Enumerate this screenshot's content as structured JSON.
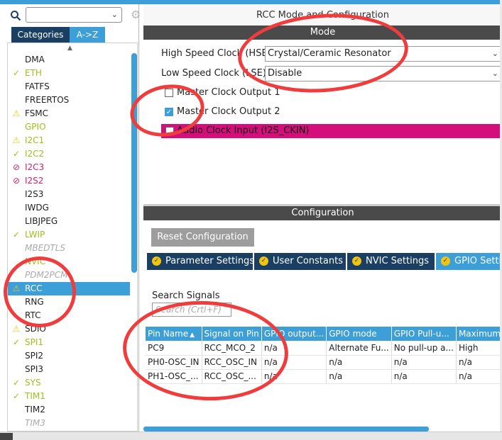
{
  "left_panel": {
    "search": {
      "value": ""
    },
    "tabs": {
      "categories": "Categories",
      "az": "A->Z"
    },
    "items": [
      {
        "label": "DMA",
        "icon": "",
        "style": "normal"
      },
      {
        "label": "ETH",
        "icon": "check",
        "style": "green"
      },
      {
        "label": "FATFS",
        "icon": "",
        "style": "normal"
      },
      {
        "label": "FREERTOS",
        "icon": "",
        "style": "normal"
      },
      {
        "label": "FSMC",
        "icon": "warn",
        "style": "normal"
      },
      {
        "label": "GPIO",
        "icon": "",
        "style": "green"
      },
      {
        "label": "I2C1",
        "icon": "warn",
        "style": "green"
      },
      {
        "label": "I2C2",
        "icon": "check",
        "style": "green"
      },
      {
        "label": "I2C3",
        "icon": "ban",
        "style": "pink"
      },
      {
        "label": "I2S2",
        "icon": "ban",
        "style": "pink"
      },
      {
        "label": "I2S3",
        "icon": "",
        "style": "normal"
      },
      {
        "label": "IWDG",
        "icon": "",
        "style": "normal"
      },
      {
        "label": "LIBJPEG",
        "icon": "",
        "style": "normal"
      },
      {
        "label": "LWIP",
        "icon": "check",
        "style": "green"
      },
      {
        "label": "MBEDTLS",
        "icon": "",
        "style": "gray"
      },
      {
        "label": "NVIC",
        "icon": "",
        "style": "green"
      },
      {
        "label": "PDM2PCM",
        "icon": "",
        "style": "gray"
      },
      {
        "label": "RCC",
        "icon": "warn",
        "style": "selected"
      },
      {
        "label": "RNG",
        "icon": "",
        "style": "normal"
      },
      {
        "label": "RTC",
        "icon": "",
        "style": "normal"
      },
      {
        "label": "SDIO",
        "icon": "warn",
        "style": "normal"
      },
      {
        "label": "SPI1",
        "icon": "check",
        "style": "green"
      },
      {
        "label": "SPI2",
        "icon": "",
        "style": "normal"
      },
      {
        "label": "SPI3",
        "icon": "",
        "style": "normal"
      },
      {
        "label": "SYS",
        "icon": "check",
        "style": "green"
      },
      {
        "label": "TIM1",
        "icon": "check",
        "style": "green"
      },
      {
        "label": "TIM2",
        "icon": "",
        "style": "normal"
      },
      {
        "label": "TIM3",
        "icon": "",
        "style": "gray"
      }
    ]
  },
  "right_panel": {
    "title": "RCC Mode and Configuration",
    "mode_bar": "Mode",
    "hse": {
      "label": "High Speed Clock (HSE)",
      "value": "Crystal/Ceramic Resonator"
    },
    "lse": {
      "label": "Low Speed Clock (LSE)",
      "value": "Disable"
    },
    "mco1": {
      "label": "Master Clock Output 1",
      "checked": false
    },
    "mco2": {
      "label": "Master Clock Output 2",
      "checked": true
    },
    "audio": {
      "label": "Audio Clock Input (I2S_CKIN)",
      "checked": false
    },
    "config_bar": "Configuration",
    "reset_button": "Reset Configuration",
    "config_tabs": [
      "Parameter Settings",
      "User Constants",
      "NVIC Settings",
      "GPIO Settings"
    ],
    "search_signals": {
      "label": "Search Signals",
      "placeholder": "Search (Crtl+F)"
    },
    "table": {
      "headers": [
        "Pin Name",
        "Signal on Pin",
        "GPIO output...",
        "GPIO mode",
        "GPIO Pull-u...",
        "Maximum"
      ],
      "rows": [
        [
          "PC9",
          "RCC_MCO_2",
          "n/a",
          "Alternate Fu...",
          "No pull-up a...",
          "High"
        ],
        [
          "PH0-OSC_IN",
          "RCC_OSC_IN",
          "n/a",
          "n/a",
          "n/a",
          "n/a"
        ],
        [
          "PH1-OSC_...",
          "RCC_OSC_...",
          "n/a",
          "n/a",
          "n/a",
          "n/a"
        ]
      ]
    }
  },
  "colors": {
    "accent_blue": "#3c9fd8",
    "dark_navy": "#1a3f62",
    "annotation_red": "#f03c3c",
    "magenta_row": "#d40e7a"
  }
}
